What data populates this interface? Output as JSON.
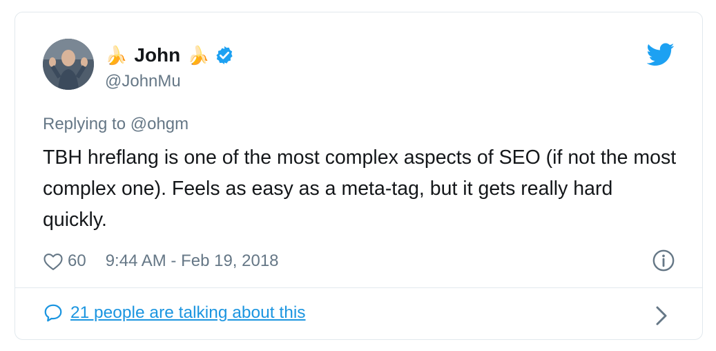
{
  "tweet": {
    "author": {
      "name": "John",
      "name_emoji": "🍌",
      "handle": "@JohnMu",
      "verified": true
    },
    "replying_to_prefix": "Replying to ",
    "replying_to_handle": "@ohgm",
    "text": "TBH hreflang is one of the most complex aspects of SEO (if not the most complex one). Feels as easy as a meta-tag, but it gets really hard quickly.",
    "likes": "60",
    "timestamp": "9:44 AM - Feb 19, 2018",
    "conversation_link": "21 people are talking about this"
  },
  "colors": {
    "twitter_blue": "#1da1f2",
    "link_blue": "#1b95e0",
    "secondary_text": "#657786",
    "border": "#e1e8ed"
  },
  "icons": [
    "avatar",
    "banana-emoji",
    "verified-badge-icon",
    "twitter-bird-icon",
    "heart-icon",
    "info-icon",
    "speech-bubble-icon",
    "chevron-right-icon"
  ]
}
